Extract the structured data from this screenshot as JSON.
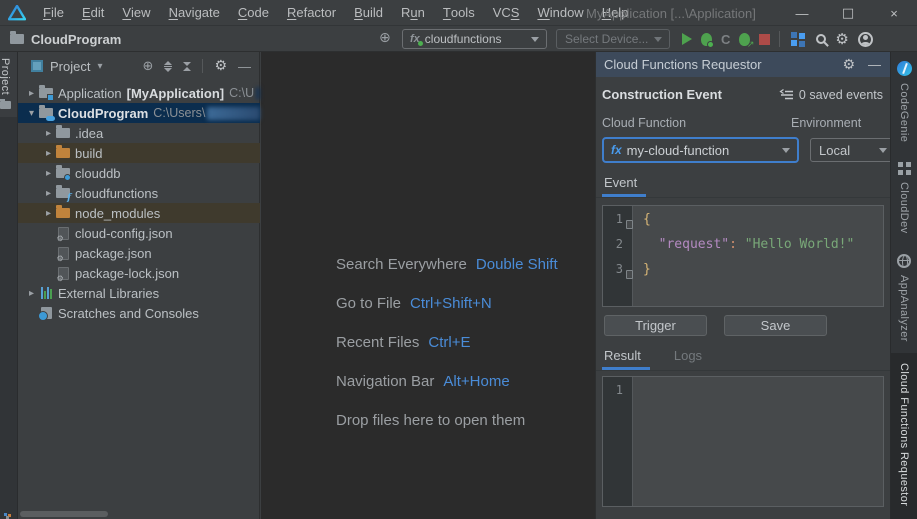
{
  "window": {
    "title": "MyApplication [...\\Application]",
    "controls": {
      "minimize": "—",
      "maximize": "□",
      "close": "×"
    }
  },
  "menu": {
    "items": [
      {
        "label": "File",
        "mnemonic": "F"
      },
      {
        "label": "Edit",
        "mnemonic": "E"
      },
      {
        "label": "View",
        "mnemonic": "V"
      },
      {
        "label": "Navigate",
        "mnemonic": "N"
      },
      {
        "label": "Code",
        "mnemonic": "C"
      },
      {
        "label": "Refactor",
        "mnemonic": "R"
      },
      {
        "label": "Build",
        "mnemonic": "B"
      },
      {
        "label": "Run",
        "mnemonic": "u"
      },
      {
        "label": "Tools",
        "mnemonic": "T"
      },
      {
        "label": "VCS",
        "mnemonic": "S"
      },
      {
        "label": "Window",
        "mnemonic": "W"
      },
      {
        "label": "Help",
        "mnemonic": "H"
      }
    ]
  },
  "toolbar": {
    "project_name": "CloudProgram",
    "run_config": {
      "label": "cloudfunctions"
    },
    "device_selector": {
      "placeholder": "Select Device..."
    }
  },
  "left_stripe": {
    "project_tab": "Project"
  },
  "project_panel": {
    "header": {
      "title": "Project",
      "caret": "▾"
    },
    "tree": [
      {
        "indent": 0,
        "chevron": "closed",
        "icon": "module-folder",
        "label": "Application",
        "suffix": "[MyApplication]",
        "path": "C:\\U",
        "redacted": true,
        "highlight": null
      },
      {
        "indent": 0,
        "chevron": "open",
        "icon": "cloud-folder",
        "label": "CloudProgram",
        "bold": true,
        "path": "C:\\Users\\",
        "redacted": true,
        "highlight": "selected"
      },
      {
        "indent": 1,
        "chevron": "closed",
        "icon": "folder",
        "label": ".idea"
      },
      {
        "indent": 1,
        "chevron": "closed",
        "icon": "folder-ex",
        "label": "build",
        "highlight": "excluded"
      },
      {
        "indent": 1,
        "chevron": "closed",
        "icon": "db-folder",
        "label": "clouddb"
      },
      {
        "indent": 1,
        "chevron": "closed",
        "icon": "func-folder",
        "label": "cloudfunctions"
      },
      {
        "indent": 1,
        "chevron": "closed",
        "icon": "folder-ex",
        "label": "node_modules",
        "highlight": "excluded"
      },
      {
        "indent": 1,
        "chevron": null,
        "icon": "json-file",
        "label": "cloud-config.json"
      },
      {
        "indent": 1,
        "chevron": null,
        "icon": "json-file",
        "label": "package.json"
      },
      {
        "indent": 1,
        "chevron": null,
        "icon": "json-file",
        "label": "package-lock.json"
      },
      {
        "indent": 0,
        "chevron": "closed",
        "icon": "libraries",
        "label": "External Libraries"
      },
      {
        "indent": 0,
        "chevron": null,
        "icon": "scratches",
        "label": "Scratches and Consoles"
      }
    ]
  },
  "editor_overlay": {
    "shortcuts": [
      {
        "label": "Search Everywhere",
        "keys": "Double Shift"
      },
      {
        "label": "Go to File",
        "keys": "Ctrl+Shift+N"
      },
      {
        "label": "Recent Files",
        "keys": "Ctrl+E"
      },
      {
        "label": "Navigation Bar",
        "keys": "Alt+Home"
      },
      {
        "label": "Drop files here to open them",
        "keys": ""
      }
    ]
  },
  "requestor_panel": {
    "title": "Cloud Functions Requestor",
    "section_title": "Construction Event",
    "saved_events": "0 saved events",
    "cloud_function_label": "Cloud Function",
    "environment_label": "Environment",
    "cloud_function_value": "my-cloud-function",
    "environment_value": "Local",
    "event_tab": "Event",
    "buttons": {
      "trigger": "Trigger",
      "save": "Save"
    },
    "result_tabs": {
      "result": "Result",
      "logs": "Logs"
    },
    "event_editor": {
      "lines": [
        {
          "num": "1",
          "fold": true,
          "tokens": [
            {
              "c": "brace",
              "t": "{"
            }
          ]
        },
        {
          "num": "2",
          "fold": false,
          "tokens": [
            {
              "c": "plain",
              "t": "  "
            },
            {
              "c": "key",
              "t": "\"request\""
            },
            {
              "c": "colon",
              "t": ": "
            },
            {
              "c": "str",
              "t": "\"Hello World!\""
            }
          ]
        },
        {
          "num": "3",
          "fold": true,
          "tokens": [
            {
              "c": "brace",
              "t": "}"
            }
          ]
        }
      ]
    },
    "result_editor": {
      "lines": [
        {
          "num": "1",
          "fold": false,
          "tokens": []
        }
      ]
    }
  },
  "right_stripe": {
    "tabs": [
      {
        "label": "CodeGenie",
        "icon": "codegenie",
        "active": false
      },
      {
        "label": "CloudDev",
        "icon": "grid",
        "active": false
      },
      {
        "label": "AppAnalyzer",
        "icon": "globe",
        "active": false
      },
      {
        "label": "Cloud Functions Requestor",
        "icon": null,
        "active": true
      }
    ]
  },
  "icons": {
    "project_caret": "▾",
    "target": "⊕",
    "gear": "⚙",
    "minus": "—",
    "chevron_closed": "▸",
    "chevron_open": "▾"
  },
  "colors": {
    "accent_blue": "#3f7ecc",
    "shortcut_blue": "#4a8cd8",
    "selected_row": "#0b2d4e",
    "excluded_row": "#3f3a2d",
    "panel_bg": "#3c3f41",
    "editor_bg": "#2b2b2b",
    "tool_header_bg": "#3d4a5b",
    "inner_editor_bg": "#46494b",
    "json_key": "#b48ac2",
    "json_string": "#79a878",
    "json_brace": "#d9b777",
    "run_green": "#4ea24e",
    "stop_red": "#ad4b48"
  }
}
